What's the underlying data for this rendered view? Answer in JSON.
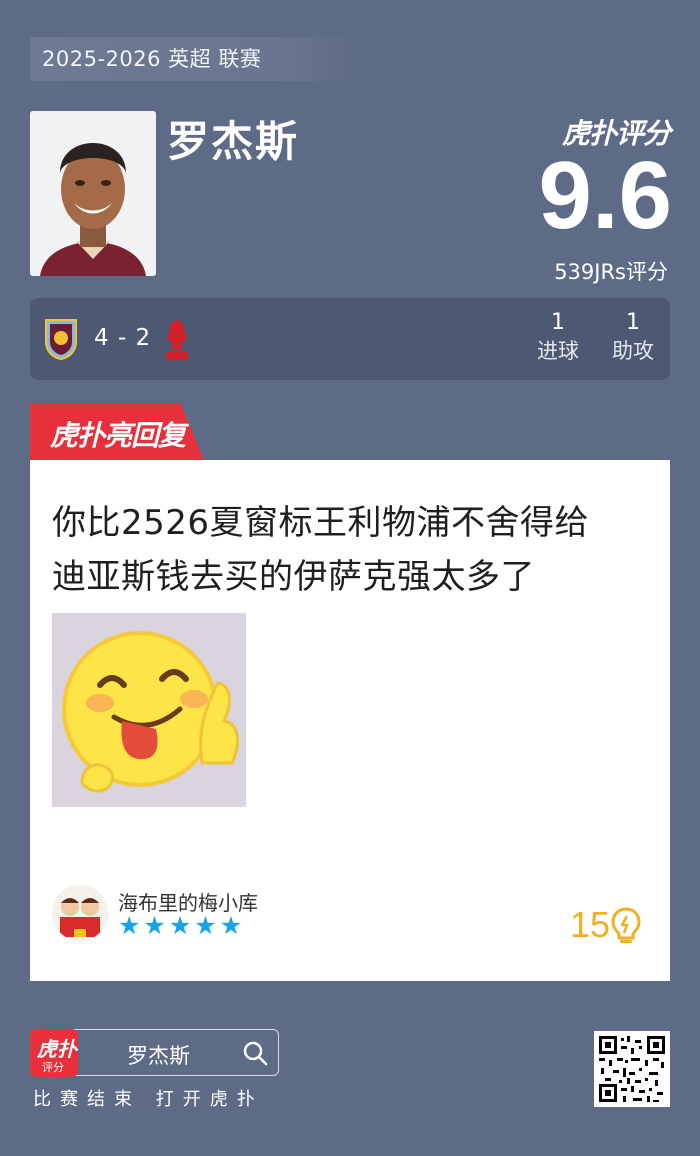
{
  "header": {
    "season_label": "2025-2026 英超 联赛",
    "player_name": "罗杰斯",
    "rating_brand": "虎扑评分",
    "rating_score": "9.6",
    "rating_count": "539JRs评分"
  },
  "match": {
    "score": "4 - 2",
    "stats": [
      {
        "value": "1",
        "label": "进球"
      },
      {
        "value": "1",
        "label": "助攻"
      }
    ]
  },
  "hot_reply": {
    "banner": "虎扑亮回复",
    "comment_line1": "你比2526夏窗标王利物浦不舍得给",
    "comment_line2": "迪亚斯钱去买的伊萨克强太多了",
    "username": "海布里的梅小库",
    "stars": 5,
    "likes": "15"
  },
  "footer": {
    "app_icon_title": "虎扑",
    "app_icon_sub": "评分",
    "search_text": "罗杰斯",
    "cta": "比赛结束 打开虎扑"
  },
  "colors": {
    "background": "#5e6b86",
    "accent_red": "#e7303b",
    "star_blue": "#18a3e8",
    "like_gold": "#f0b020"
  }
}
